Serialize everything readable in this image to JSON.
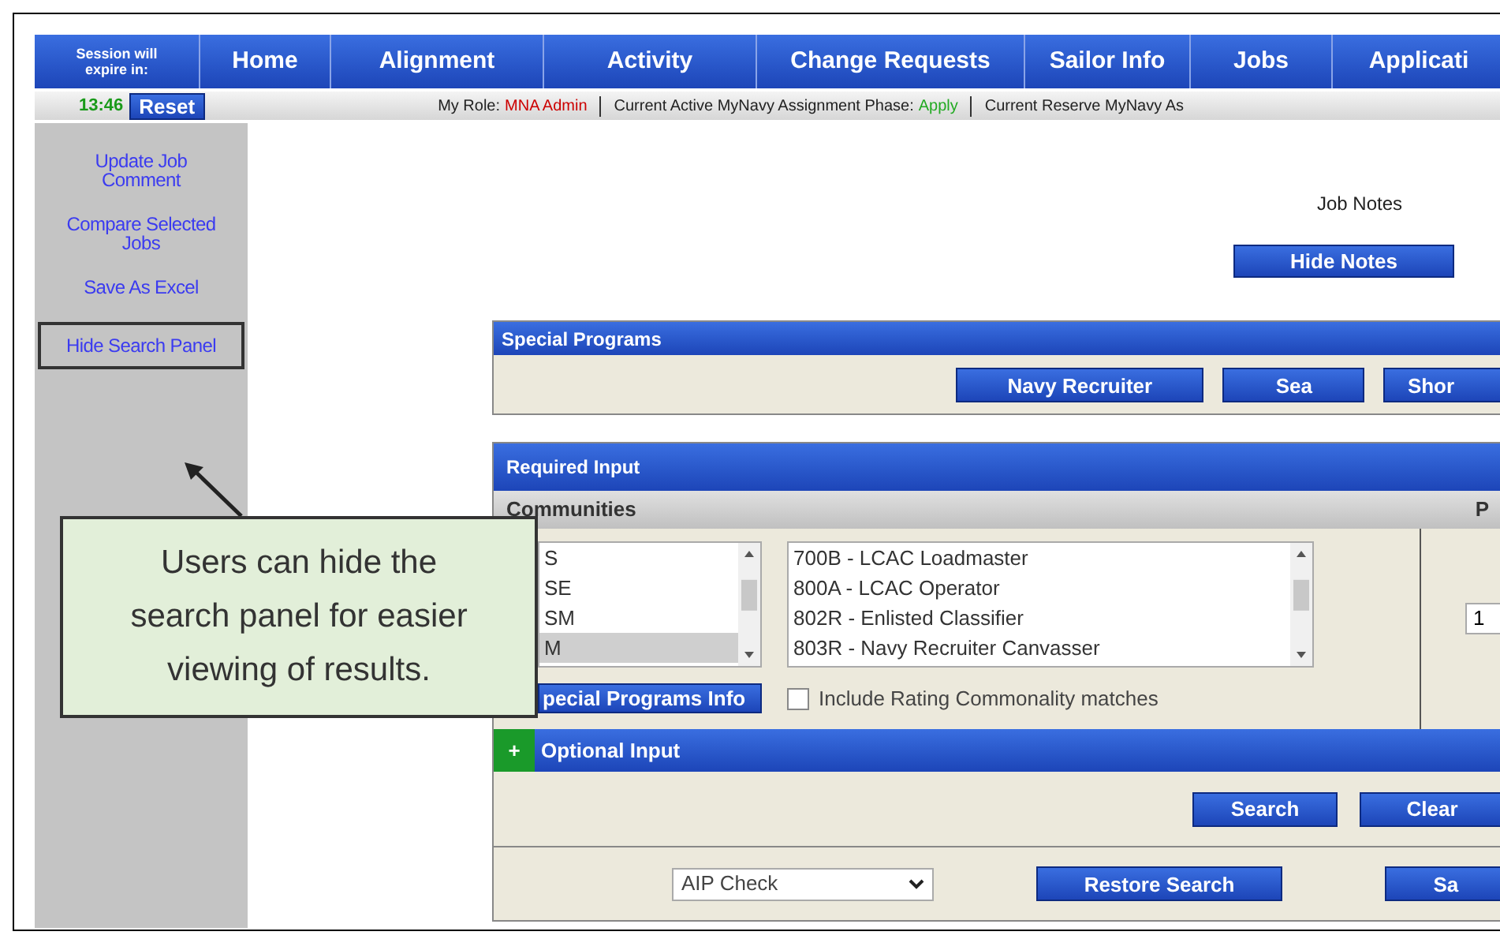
{
  "session": {
    "label": "Session will expire in:",
    "time": "13:46",
    "reset_button": "Reset"
  },
  "nav": [
    "Home",
    "Alignment",
    "Activity",
    "Change Requests",
    "Sailor Info",
    "Jobs",
    "Applicati"
  ],
  "status_fields": [
    {
      "label": "My Role:",
      "value": "MNA Admin",
      "color": "#cc0000"
    },
    {
      "label": "Current Active MyNavy Assignment Phase:",
      "value": "Apply",
      "color": "#22aa22"
    },
    {
      "label": "Current Reserve MyNavy As"
    }
  ],
  "sidebar": {
    "items": [
      {
        "label": "Update Job Comment",
        "highlighted": false
      },
      {
        "label": "Compare Selected Jobs",
        "highlighted": false
      },
      {
        "label": "Save As Excel",
        "highlighted": false
      },
      {
        "label": "Hide Search Panel",
        "highlighted": true
      }
    ]
  },
  "job_notes": {
    "label": "Job Notes",
    "button": "Hide Notes"
  },
  "special_programs": {
    "title": "Special Programs",
    "buttons": [
      "Navy Recruiter",
      "Sea",
      "Shor"
    ]
  },
  "required_input": {
    "title": "Required Input",
    "communities_label": "Communities",
    "column_2_label": "P",
    "communities": [
      {
        "label": "S",
        "selected": false
      },
      {
        "label": "SE",
        "selected": false
      },
      {
        "label": "SM",
        "selected": false
      },
      {
        "label": "M",
        "selected": true
      }
    ],
    "ratings": [
      "700B - LCAC Loadmaster",
      "800A - LCAC Operator",
      "802R - Enlisted Classifier",
      "803R - Navy Recruiter Canvasser"
    ],
    "info_button": "pecial Programs Info",
    "commonality": {
      "label": "Include Rating Commonality matches",
      "checked": false
    },
    "field_value": "1"
  },
  "optional_input": {
    "toggle": "+",
    "title": "Optional Input",
    "buttons": [
      "Search",
      "Clear"
    ]
  },
  "footer": {
    "select_value": "AIP Check",
    "buttons": [
      "Restore Search",
      "Sa"
    ]
  },
  "callout": {
    "lines": [
      "Users can hide the",
      "search panel for easier",
      "viewing of results."
    ]
  }
}
